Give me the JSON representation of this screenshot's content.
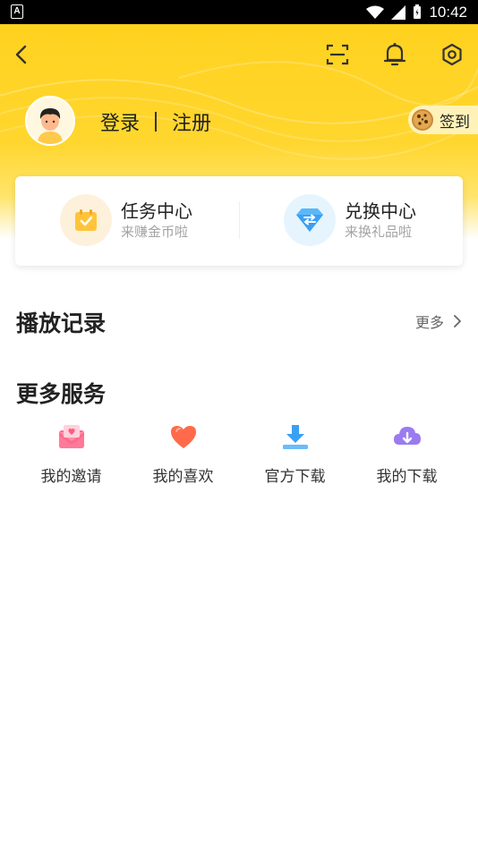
{
  "status_bar": {
    "time": "10:42",
    "left_badge": "A"
  },
  "nav": {
    "icons": [
      "back-icon",
      "scan-icon",
      "bell-icon",
      "settings-icon"
    ]
  },
  "user": {
    "login_label": "登录",
    "register_label": "注册",
    "signin_label": "签到"
  },
  "card": {
    "task": {
      "title": "任务中心",
      "subtitle": "来赚金币啦"
    },
    "exchange": {
      "title": "兑换中心",
      "subtitle": "来换礼品啦"
    }
  },
  "history": {
    "title": "播放记录",
    "more_label": "更多"
  },
  "services": {
    "title": "更多服务",
    "items": [
      {
        "label": "我的邀请",
        "icon": "invite-envelope-icon",
        "color": "#ff6b8e"
      },
      {
        "label": "我的喜欢",
        "icon": "heart-icon",
        "color": "#ff6a4a"
      },
      {
        "label": "官方下载",
        "icon": "download-icon",
        "color": "#3aa0f5"
      },
      {
        "label": "我的下载",
        "icon": "cloud-download-icon",
        "color": "#9a7cf0"
      }
    ]
  },
  "colors": {
    "header_yellow": "#ffd21f",
    "accent_text": "#222222",
    "sub_text": "#a3a3a3"
  }
}
